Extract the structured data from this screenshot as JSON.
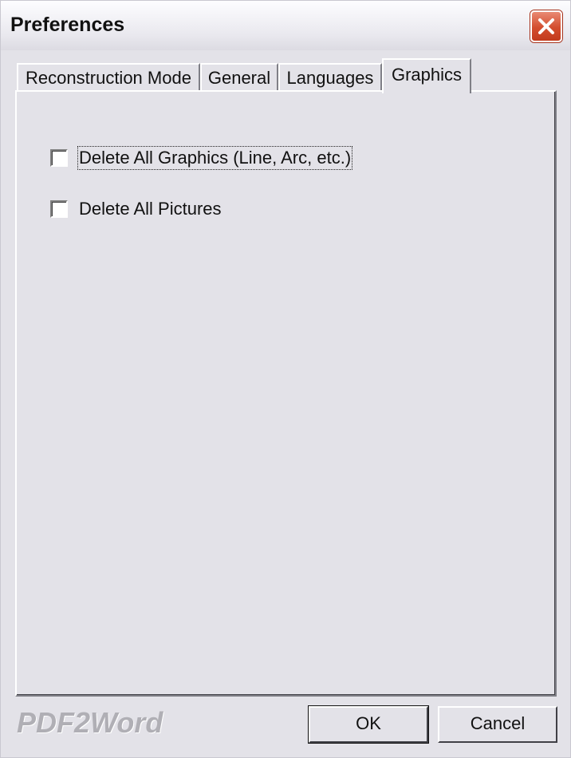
{
  "window": {
    "title": "Preferences",
    "close_icon": "close-icon"
  },
  "tabs": [
    {
      "label": "Reconstruction Mode",
      "active": false
    },
    {
      "label": "General",
      "active": false
    },
    {
      "label": "Languages",
      "active": false
    },
    {
      "label": "Graphics",
      "active": true
    }
  ],
  "graphics": {
    "options": [
      {
        "label": "Delete All Graphics (Line, Arc, etc.)",
        "checked": false,
        "focused": true
      },
      {
        "label": "Delete All Pictures",
        "checked": false,
        "focused": false
      }
    ]
  },
  "footer": {
    "logo": "PDF2Word",
    "ok_label": "OK",
    "cancel_label": "Cancel"
  },
  "colors": {
    "background": "#e3e2e8",
    "close_button": "#d34d2e"
  }
}
